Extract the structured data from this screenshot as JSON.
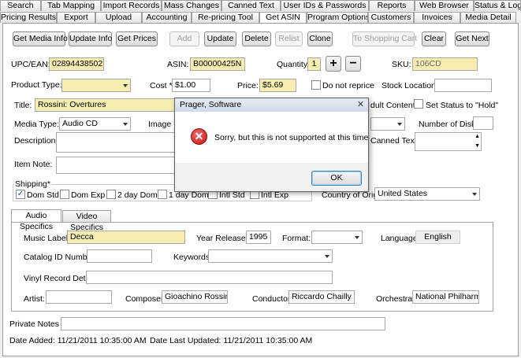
{
  "tabs_row1": [
    "Search",
    "Tab Mapping",
    "Import Records",
    "Mass Changes",
    "Canned Text",
    "User IDs & Passwords",
    "Reports",
    "Web Browser",
    "Status & Log"
  ],
  "tabs_row2": [
    "Pricing Results",
    "Export",
    "Upload",
    "Accounting",
    "Re-pricing Tool",
    "Get ASIN",
    "Program Options",
    "Customers",
    "Invoices",
    "Media Detail"
  ],
  "toolbar": {
    "get_media_info": "Get Media Info",
    "update_info": "Update Info",
    "get_prices": "Get  Prices",
    "add": "Add",
    "update": "Update",
    "delete": "Delete",
    "relist": "Relist",
    "clone": "Clone",
    "to_shopping_cart": "To Shopping Cart",
    "clear": "Clear",
    "get_next": "Get Next"
  },
  "form": {
    "upc_label": "UPC/EAN:",
    "upc_value": "028944385021",
    "asin_label": "ASIN:",
    "asin_value": "B00000425N",
    "quantity_label": "Quantity:",
    "quantity_value": "1",
    "plus": "+",
    "minus": "−",
    "sku_label": "SKU:",
    "sku_value": "106CD",
    "product_type_label": "Product Type: *",
    "product_type_value": "",
    "cost_label": "Cost *",
    "cost_value": "$1.00",
    "price_label": "Price:",
    "price_value": "$5.69",
    "do_not_reprice": "Do not reprice",
    "stock_location_label": "Stock Location *",
    "stock_location_value": "",
    "title_label": "Title:",
    "title_value": "Rossini: Overtures",
    "adult_content": "dult Content",
    "set_status_hold": "Set Status to \"Hold\"",
    "media_type_label": "Media Type: *",
    "media_type_value": "Audio CD",
    "image_url_label": "Image U",
    "number_of_disks_label": "Number of Disks:",
    "number_of_disks_value": "",
    "description_label": "Description:",
    "canned_text_label": "Canned Text:",
    "item_note_label": "Item Note:",
    "shipping_label": "Shipping*",
    "ship_dom_std": "Dom Std",
    "ship_dom_exp": "Dom Exp",
    "ship_2day": "2 day Dom",
    "ship_1day": "1 day Dom",
    "ship_intl_std": "Intl Std",
    "ship_intl_exp": "Intl Exp",
    "country_label": "Country of Origin",
    "country_value": "United States"
  },
  "subtabs": [
    "Audio Specifics",
    "Video Specifics"
  ],
  "audio": {
    "music_label_label": "Music Label:",
    "music_label_value": "Decca",
    "year_released_label": "Year Released:",
    "year_released_value": "1995",
    "format_label": "Format:",
    "format_value": "",
    "language_label": "Language:",
    "language_value": "English",
    "catalog_id_label": "Catalog ID Number:",
    "catalog_id_value": "",
    "keywords_label": "Keywords:",
    "keywords_value": "",
    "vinyl_label": "Vinyl Record Details:",
    "vinyl_value": "",
    "artist_label": "Artist:",
    "artist_value": "",
    "composer_label": "Composer:",
    "composer_value": "Gioachino Rossini",
    "conductor_label": "Conductor:",
    "conductor_value": "Riccardo Chailly",
    "orchestra_label": "Orchestra:",
    "orchestra_value": "National Philharmonic"
  },
  "footer": {
    "private_notes_label": "Private Notes *",
    "private_notes_value": "",
    "date_added": "Date Added: 11/21/2011 10:35:00 AM",
    "date_updated": "Date Last Updated: 11/21/2011 10:35:00 AM"
  },
  "dialog": {
    "title": "Prager, Software",
    "close": "✕",
    "icon": "error-icon",
    "message": "Sorry, but this is not supported at this time",
    "ok": "OK"
  }
}
